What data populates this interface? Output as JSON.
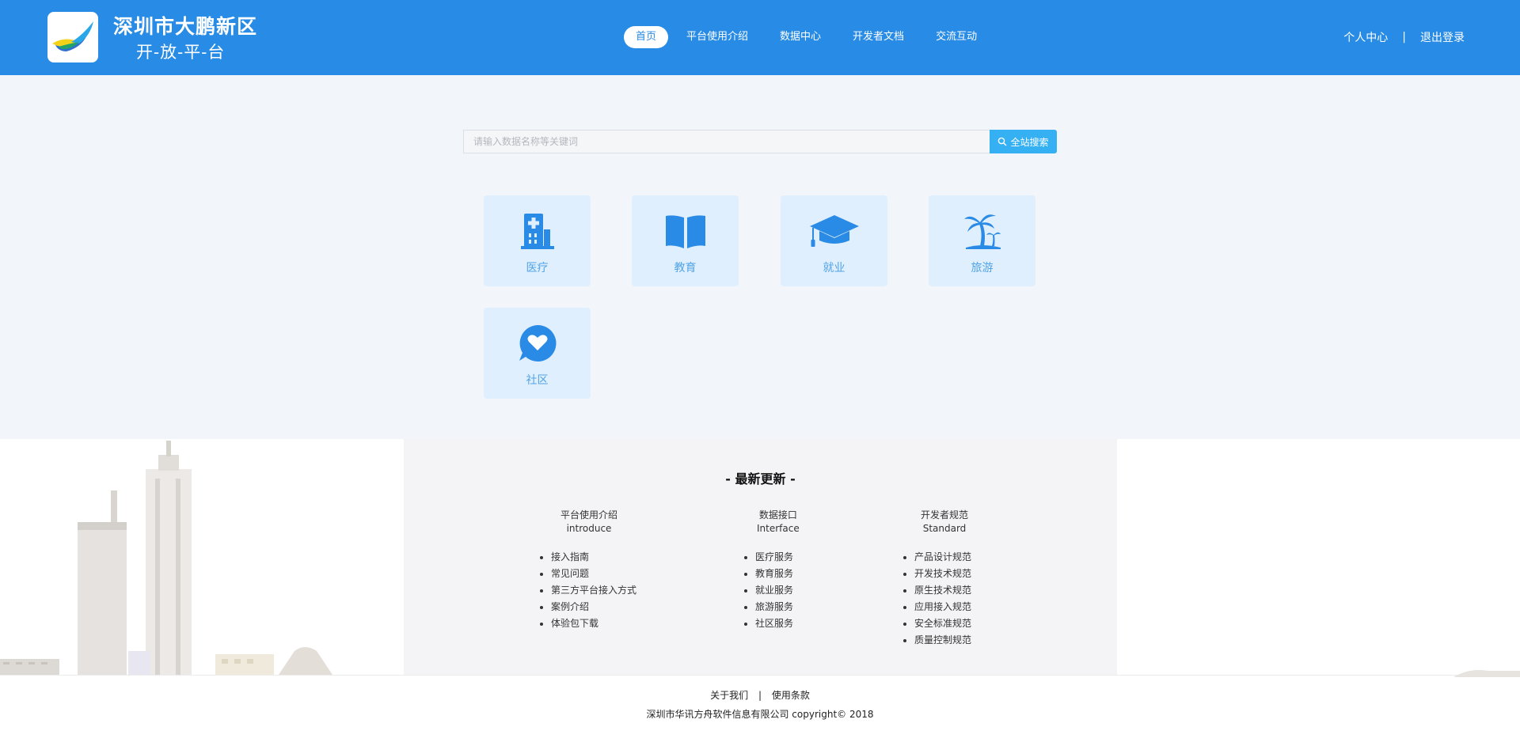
{
  "header": {
    "brand_title": "深圳市大鹏新区",
    "brand_subtitle": "开-放-平-台",
    "nav": [
      {
        "label": "首页",
        "active": true
      },
      {
        "label": "平台使用介绍",
        "active": false
      },
      {
        "label": "数据中心",
        "active": false
      },
      {
        "label": "开发者文档",
        "active": false
      },
      {
        "label": "交流互动",
        "active": false
      }
    ],
    "user_center": "个人中心",
    "separator": "|",
    "logout": "退出登录"
  },
  "search": {
    "placeholder": "请输入数据名称等关键词",
    "button_label": "全站搜索",
    "button_icon": "search-icon"
  },
  "services": [
    {
      "label": "医疗",
      "icon": "hospital-icon"
    },
    {
      "label": "教育",
      "icon": "book-icon"
    },
    {
      "label": "就业",
      "icon": "graduation-cap-icon"
    },
    {
      "label": "旅游",
      "icon": "palm-tree-icon"
    },
    {
      "label": "社区",
      "icon": "heart-chat-icon"
    }
  ],
  "updates": {
    "title": "- 最新更新 -",
    "columns": [
      {
        "title_cn": "平台使用介绍",
        "title_en": "introduce",
        "items": [
          "接入指南",
          "常见问题",
          "第三方平台接入方式",
          "案例介绍",
          "体验包下载"
        ]
      },
      {
        "title_cn": "数据接口",
        "title_en": "Interface",
        "items": [
          "医疗服务",
          "教育服务",
          "就业服务",
          "旅游服务",
          "社区服务"
        ]
      },
      {
        "title_cn": "开发者规范",
        "title_en": "Standard",
        "items": [
          "产品设计规范",
          "开发技术规范",
          "原生技术规范",
          "应用接入规范",
          "安全标准规范",
          "质量控制规范"
        ]
      }
    ]
  },
  "footer": {
    "about": "关于我们",
    "separator": "|",
    "terms": "使用条款",
    "copyright": "深圳市华讯方舟软件信息有限公司  copyright©  2018"
  },
  "colors": {
    "header_bg": "#288be5",
    "accent": "#35b0f2",
    "card_bg": "#e0effd",
    "icon_blue": "#2a8be6",
    "hero_bg": "#f2f6fb"
  }
}
